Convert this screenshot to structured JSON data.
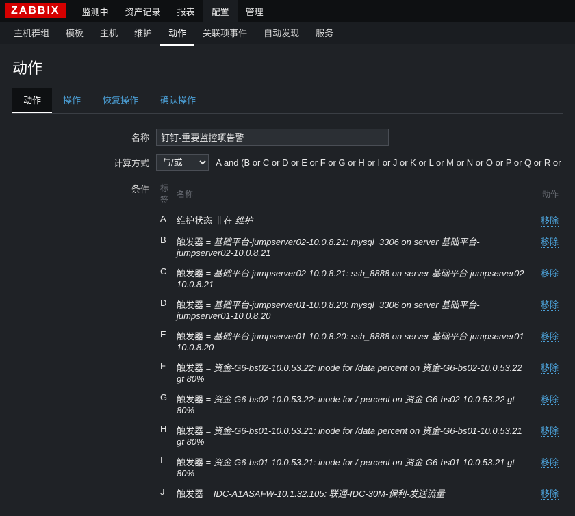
{
  "logo": "ZABBIX",
  "topnav": {
    "items": [
      {
        "label": "监测中"
      },
      {
        "label": "资产记录"
      },
      {
        "label": "报表"
      },
      {
        "label": "配置",
        "active": true
      },
      {
        "label": "管理"
      }
    ]
  },
  "subnav": {
    "items": [
      {
        "label": "主机群组"
      },
      {
        "label": "模板"
      },
      {
        "label": "主机"
      },
      {
        "label": "维护"
      },
      {
        "label": "动作",
        "active": true
      },
      {
        "label": "关联项事件"
      },
      {
        "label": "自动发现"
      },
      {
        "label": "服务"
      }
    ]
  },
  "page": {
    "title": "动作"
  },
  "tabs": {
    "items": [
      {
        "label": "动作",
        "active": true
      },
      {
        "label": "操作"
      },
      {
        "label": "恢复操作"
      },
      {
        "label": "确认操作"
      }
    ]
  },
  "form": {
    "name_label": "名称",
    "name_value": "钉钉-重要监控项告警",
    "calc_label": "计算方式",
    "calc_value": "与/或",
    "formula": "A and (B or C or D or E or F or G or H or I or J or K or L or M or N or O or P or Q or R or S or T or U or V)",
    "cond_label": "条件",
    "cond_headers": {
      "tag": "标签",
      "name": "名称",
      "action": "动作"
    },
    "remove_label": "移除",
    "conditions": [
      {
        "tag": "A",
        "prefix": "维护状态 非在 ",
        "value": "维护"
      },
      {
        "tag": "B",
        "prefix": "触发器 = ",
        "value": "基础平台-jumpserver02-10.0.8.21: mysql_3306 on server 基础平台-jumpserver02-10.0.8.21"
      },
      {
        "tag": "C",
        "prefix": "触发器 = ",
        "value": "基础平台-jumpserver02-10.0.8.21: ssh_8888 on server 基础平台-jumpserver02-10.0.8.21"
      },
      {
        "tag": "D",
        "prefix": "触发器 = ",
        "value": "基础平台-jumpserver01-10.0.8.20: mysql_3306 on server 基础平台-jumpserver01-10.0.8.20"
      },
      {
        "tag": "E",
        "prefix": "触发器 = ",
        "value": "基础平台-jumpserver01-10.0.8.20: ssh_8888 on server 基础平台-jumpserver01-10.0.8.20"
      },
      {
        "tag": "F",
        "prefix": "触发器 = ",
        "value": "资金-G6-bs02-10.0.53.22: inode for /data percent on 资金-G6-bs02-10.0.53.22 gt 80%"
      },
      {
        "tag": "G",
        "prefix": "触发器 = ",
        "value": "资金-G6-bs02-10.0.53.22: inode for / percent on 资金-G6-bs02-10.0.53.22 gt 80%"
      },
      {
        "tag": "H",
        "prefix": "触发器 = ",
        "value": "资金-G6-bs01-10.0.53.21: inode for /data percent on 资金-G6-bs01-10.0.53.21 gt 80%"
      },
      {
        "tag": "I",
        "prefix": "触发器 = ",
        "value": "资金-G6-bs01-10.0.53.21: inode for / percent on 资金-G6-bs01-10.0.53.21 gt 80%"
      },
      {
        "tag": "J",
        "prefix": "触发器 = ",
        "value": "IDC-A1ASAFW-10.1.32.105: 联通-IDC-30M-保利-发送流量"
      }
    ]
  }
}
